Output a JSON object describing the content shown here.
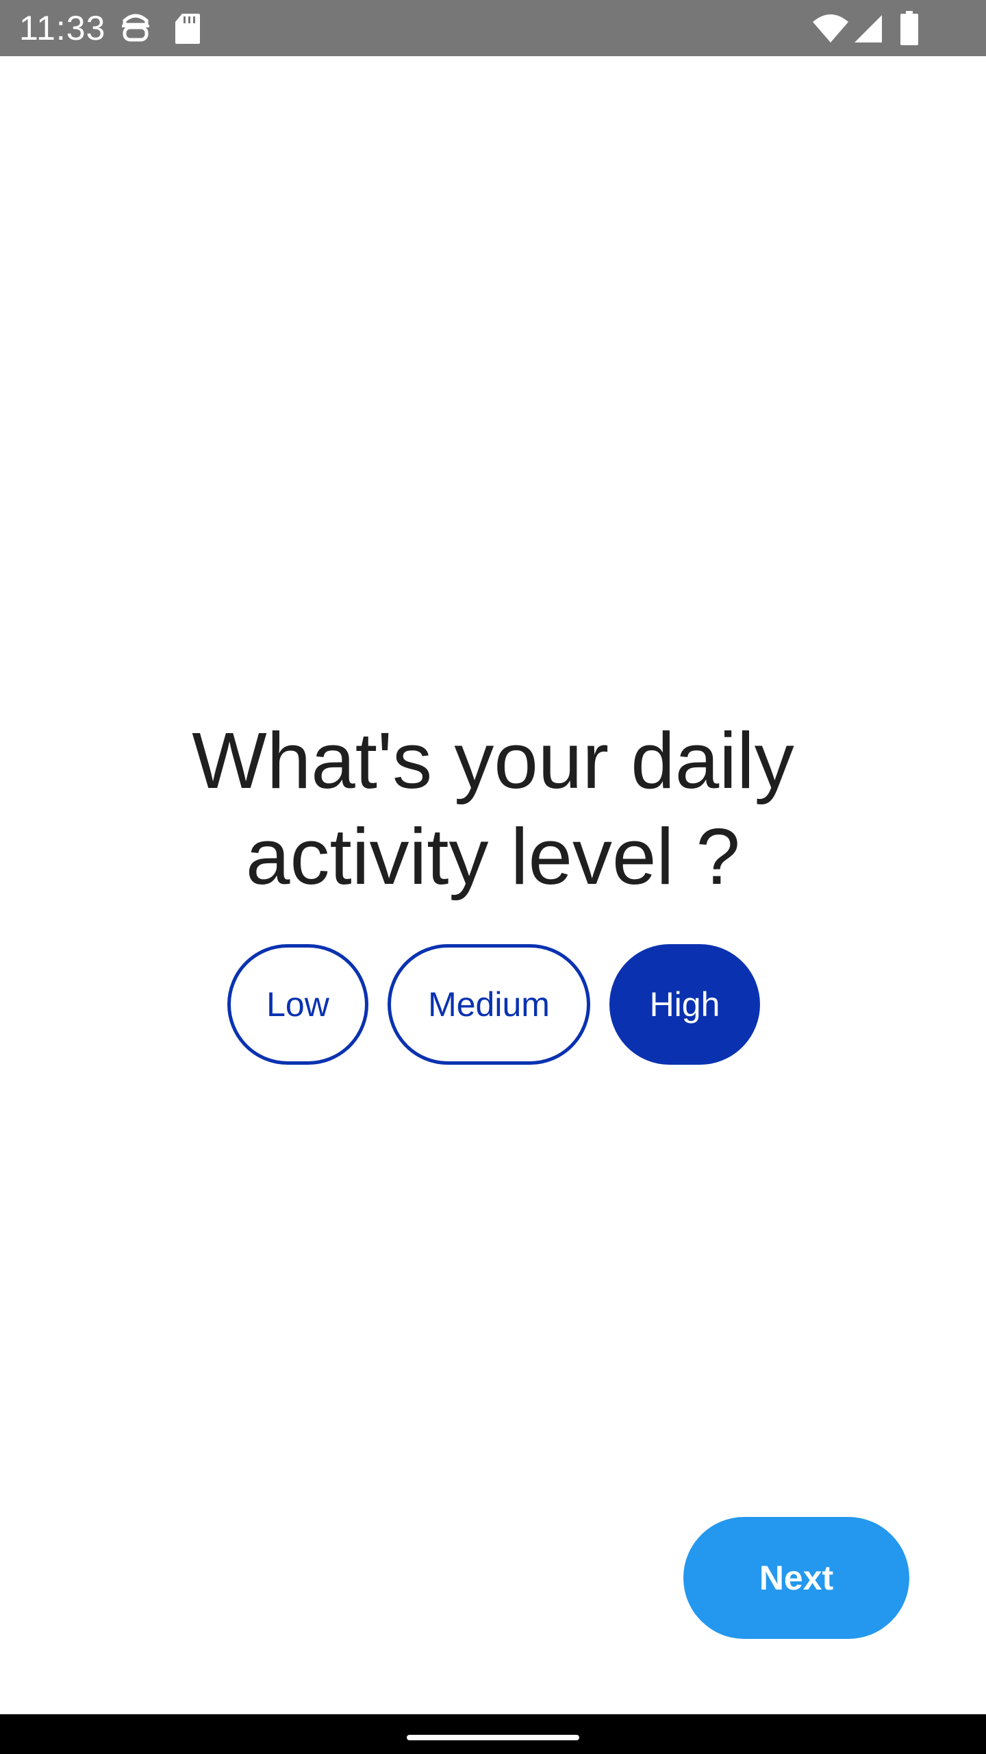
{
  "status_bar": {
    "time": "11:33",
    "icons": [
      "android-debug-icon",
      "sd-card-icon",
      "wifi-icon",
      "cellular-signal-icon",
      "battery-icon"
    ]
  },
  "question": {
    "line1": "What's your daily",
    "line2": "activity level ?"
  },
  "options": [
    {
      "label": "Low",
      "selected": false
    },
    {
      "label": "Medium",
      "selected": false
    },
    {
      "label": "High",
      "selected": true
    }
  ],
  "next_button": {
    "label": "Next"
  },
  "colors": {
    "accent": "#0a32b0",
    "next_button": "#2398ee",
    "status_bar": "#777777",
    "text": "#1f1f1f"
  }
}
